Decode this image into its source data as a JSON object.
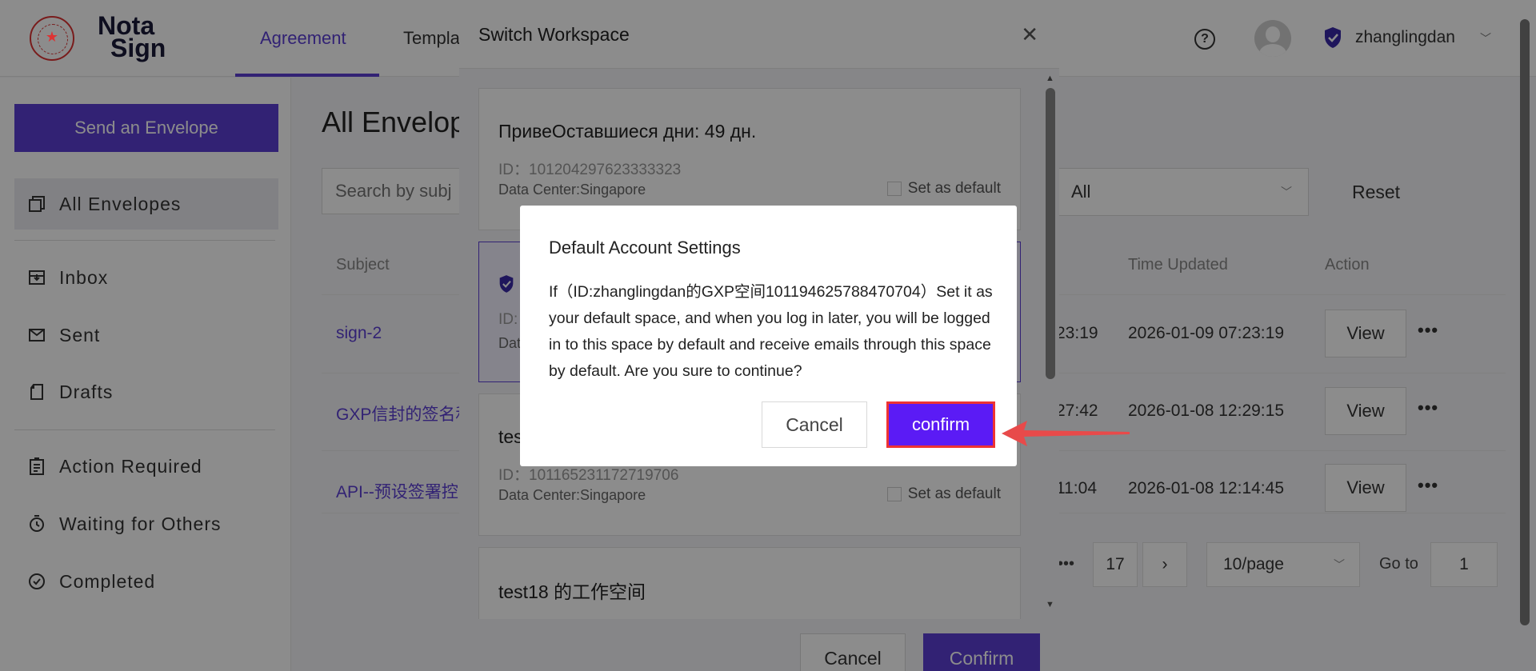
{
  "header": {
    "logo_line1": "Nota",
    "logo_line2": "Sign",
    "tabs": [
      {
        "label": "Agreement"
      },
      {
        "label": "Templa"
      }
    ],
    "help_glyph": "?",
    "username": "zhanglingdan"
  },
  "sidebar": {
    "send_label": "Send an Envelope",
    "items": [
      {
        "label": "All Envelopes",
        "icon": "copy-icon"
      },
      {
        "label": "Inbox",
        "icon": "inbox-icon"
      },
      {
        "label": "Sent",
        "icon": "sent-icon"
      },
      {
        "label": "Drafts",
        "icon": "drafts-icon"
      },
      {
        "label": "Action Required",
        "icon": "clipboard-icon"
      },
      {
        "label": "Waiting for Others",
        "icon": "timer-icon"
      },
      {
        "label": "Completed",
        "icon": "check-circle-icon"
      }
    ]
  },
  "main": {
    "title": "All Envelop",
    "search_placeholder": "Search by subj",
    "filter_value": "All",
    "reset_label": "Reset",
    "columns": {
      "subject": "Subject",
      "time_updated": "Time Updated",
      "action": "Action"
    },
    "rows": [
      {
        "subject": "sign-2",
        "time_partial": "23:19",
        "time_updated": "2026-01-09 07:23:19",
        "action": "View"
      },
      {
        "subject": "GXP信封的签名和",
        "time_partial": "27:42",
        "time_updated": "2026-01-08 12:29:15",
        "action": "View"
      },
      {
        "subject": "API--预设签署控",
        "time_partial": "11:04",
        "time_updated": "2026-01-08 12:14:45",
        "action": "View"
      }
    ],
    "pager": {
      "ellipsis": "•••",
      "last_page": "17",
      "next": "›",
      "page_size": "10/page",
      "goto_label": "Go to",
      "goto_value": "1"
    }
  },
  "workspace_panel": {
    "title": "Switch Workspace",
    "cards": [
      {
        "name": "ПривеОставшиеся дни: 49 дн.",
        "id": "ID：101204297623333323",
        "data_center": "Data Center:Singapore",
        "default_label": "Set as default"
      },
      {
        "id_prefix": "ID:",
        "dc_prefix": "Dat"
      },
      {
        "name": "tes",
        "id": "ID：101165231172719706",
        "data_center": "Data Center:Singapore",
        "default_label": "Set as default"
      },
      {
        "name": "test18 的工作空间"
      }
    ],
    "cancel_label": "Cancel",
    "confirm_label": "Confirm"
  },
  "dialog": {
    "title": "Default Account Settings",
    "body": "If（ID:zhanglingdan的GXP空间101194625788470704）Set it as your default space, and when you log in later, you will be logged in to this space by default and receive emails through this space by default. Are you sure to continue?",
    "cancel_label": "Cancel",
    "confirm_label": "confirm"
  },
  "colors": {
    "accent": "#5b3fd4",
    "highlight": "#e33333"
  }
}
